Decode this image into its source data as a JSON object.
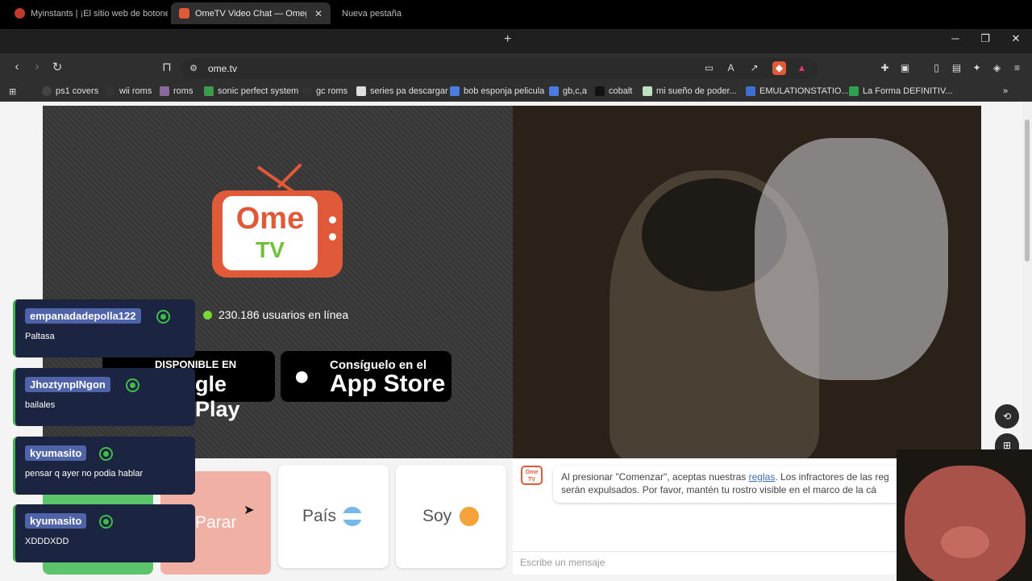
{
  "browser": {
    "tabs": [
      {
        "label": "Myinstants | ¡El sitio web de botones",
        "active": false
      },
      {
        "label": "OmeTV Video Chat — Omegl",
        "active": true
      },
      {
        "label": "Nueva pestaña",
        "active": false
      }
    ],
    "new_tab_glyph": "+",
    "url": "ome.tv",
    "bookmarks": [
      "ps1 covers",
      "wii roms",
      "roms",
      "sonic perfect system",
      "gc roms",
      "series pa descargar",
      "bob esponja pelicula",
      "gb,c,a",
      "cobalt",
      "mi sueño de poder...",
      "EMULATIONSTATIO...",
      "La Forma DEFINITIV..."
    ]
  },
  "logo": {
    "top": "Ome",
    "bottom": "TV"
  },
  "online": {
    "text": "230.186 usuarios en línea"
  },
  "stores": {
    "google_small": "DISPONIBLE EN",
    "google_big": "gle Play",
    "apple_small": "Consíguelo en el",
    "apple_big": "App Store"
  },
  "notifications": [
    {
      "user": "empanadadepolla122",
      "message": "Paltasa"
    },
    {
      "user": "JhoztynpINgon",
      "message": "bailales"
    },
    {
      "user": "kyumasito",
      "message": "pensar q ayer no podia hablar"
    },
    {
      "user": "kyumasito",
      "message": "XDDDXDD"
    }
  ],
  "controls": {
    "stop": "Parar",
    "country": "País",
    "gender": "Soy"
  },
  "chat": {
    "line1_pre": "Al presionar \"Comenzar\", aceptas nuestras ",
    "line1_link": "reglas",
    "line1_post": ". Los infractores de las reg",
    "line2": "serán expulsados. Por favor, mantén tu rostro visible en el marco de la cá",
    "placeholder": "Escribe un mensaje",
    "logo_top": "Ome",
    "logo_bottom": "TV"
  },
  "colors": {
    "brand": "#e05a3a",
    "green": "#6fbf3a",
    "notif_bg": "#1b2440"
  }
}
